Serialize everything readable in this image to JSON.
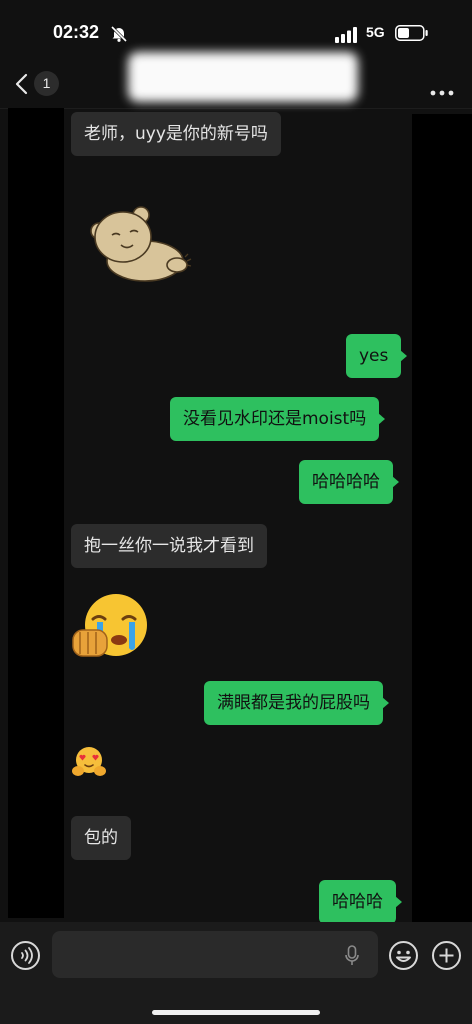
{
  "status": {
    "time": "02:32",
    "network": "5G"
  },
  "nav": {
    "unread_count": "1"
  },
  "messages": [
    {
      "dir": "in",
      "type": "text",
      "text": "老师，uyy是你的新号吗"
    },
    {
      "dir": "in",
      "type": "sticker",
      "icon": "bear-sticker"
    },
    {
      "dir": "out",
      "type": "text",
      "text": "yes"
    },
    {
      "dir": "out",
      "type": "text",
      "text": "没看见水印还是moist吗"
    },
    {
      "dir": "out",
      "type": "text",
      "text": "哈哈哈哈"
    },
    {
      "dir": "in",
      "type": "text",
      "text": "抱一丝你一说我才看到"
    },
    {
      "dir": "in",
      "type": "emoji",
      "icon": "crying-emoji"
    },
    {
      "dir": "out",
      "type": "text",
      "text": "满眼都是我的屁股吗"
    },
    {
      "dir": "in",
      "type": "emoji",
      "icon": "hug-heart-eyes-emoji"
    },
    {
      "dir": "in",
      "type": "text",
      "text": "包的"
    },
    {
      "dir": "out",
      "type": "text",
      "text": "哈哈哈"
    }
  ],
  "colors": {
    "outgoing": "#2ec05f",
    "incoming": "#2c2c2c",
    "background": "#111111"
  }
}
